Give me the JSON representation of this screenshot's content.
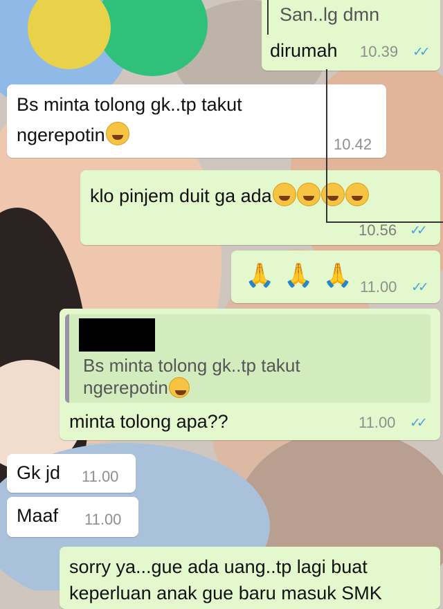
{
  "messages": [
    {
      "id": "m1",
      "lines": [
        "San..lg dmn"
      ]
    },
    {
      "id": "m2",
      "text": "dirumah",
      "time": "10.39",
      "ticks": "✓✓"
    },
    {
      "id": "m3",
      "lines": [
        "Bs minta tolong gk..tp takut",
        "ngerepotin"
      ],
      "time": "10.42"
    },
    {
      "id": "m4",
      "text": "klo pinjem duit ga ada",
      "time": "10.56",
      "ticks": "✓✓"
    },
    {
      "id": "m5",
      "emoji": "🙏🙏🙏",
      "time": "11.00",
      "ticks": "✓✓"
    },
    {
      "id": "m6",
      "quoted_lines": [
        "Bs minta tolong gk..tp takut",
        "ngerepotin"
      ],
      "text": "minta tolong apa??",
      "time": "11.00",
      "ticks": "✓✓"
    },
    {
      "id": "m7",
      "text": "Gk jd",
      "time": "11.00"
    },
    {
      "id": "m8",
      "text": "Maaf",
      "time": "11.00"
    },
    {
      "id": "m9",
      "lines": [
        "sorry ya...gue ada uang..tp lagi buat",
        "keperluan anak gue baru masuk SMK"
      ]
    }
  ],
  "colors": {
    "outgoing_bubble": "#e3f8cc",
    "incoming_bubble": "#ffffff",
    "read_ticks": "#4aa3dc"
  }
}
